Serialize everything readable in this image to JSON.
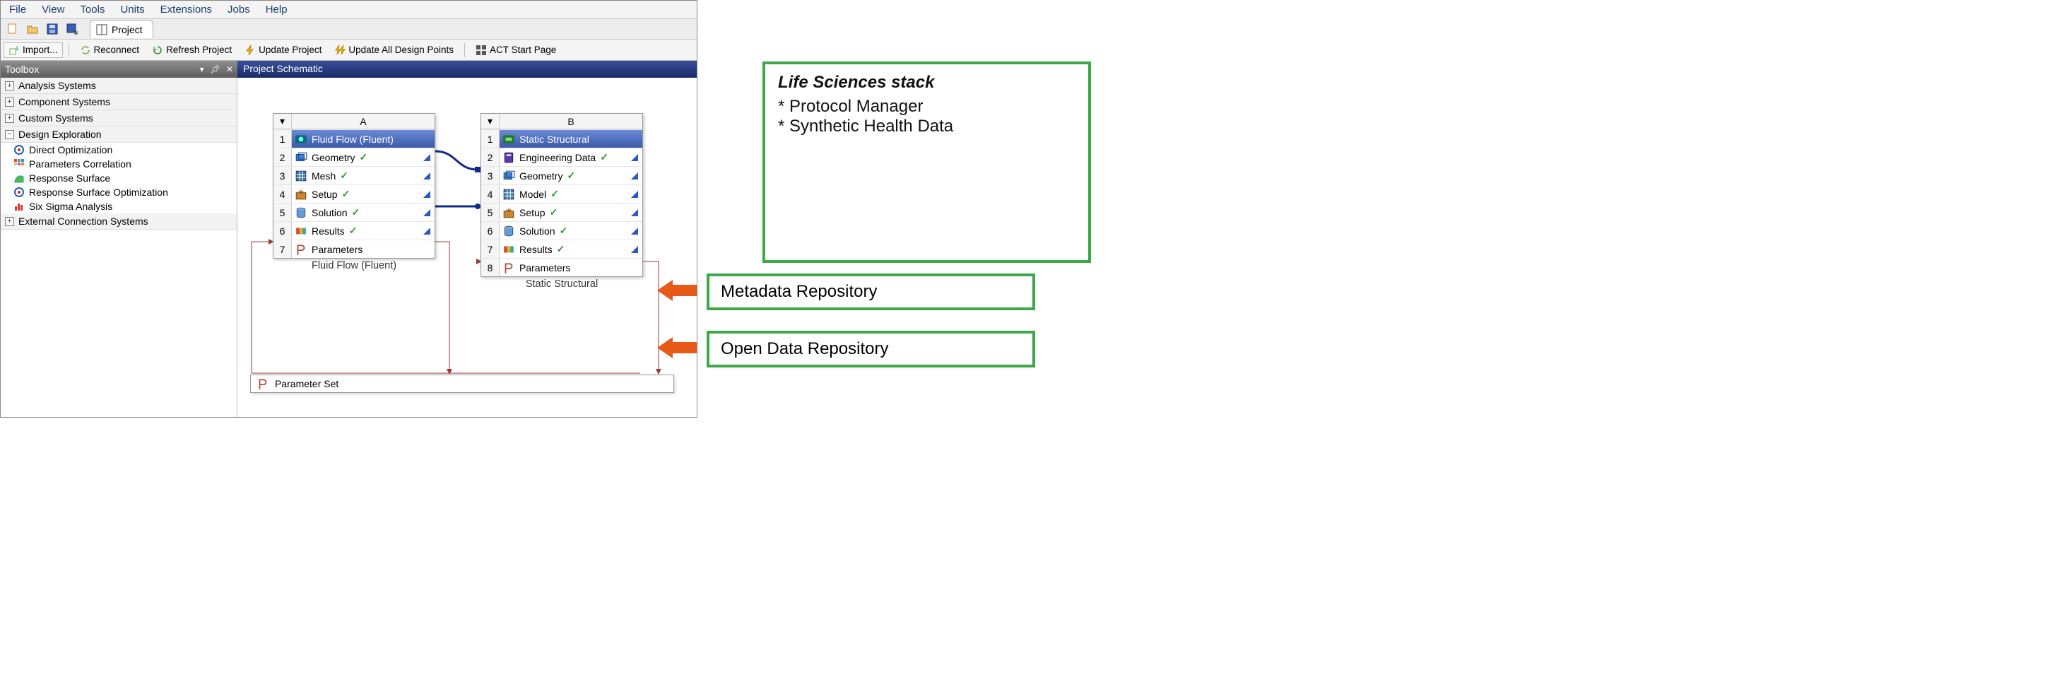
{
  "menu": {
    "items": [
      "File",
      "View",
      "Tools",
      "Units",
      "Extensions",
      "Jobs",
      "Help"
    ]
  },
  "tab": {
    "label": "Project"
  },
  "toolbar2": {
    "import": "Import...",
    "reconnect": "Reconnect",
    "refresh": "Refresh Project",
    "update": "Update Project",
    "update_all": "Update All Design Points",
    "act": "ACT Start Page"
  },
  "panels": {
    "toolbox": "Toolbox",
    "schematic": "Project Schematic"
  },
  "toolbox": {
    "categories": [
      {
        "label": "Analysis Systems",
        "expanded": false
      },
      {
        "label": "Component Systems",
        "expanded": false
      },
      {
        "label": "Custom Systems",
        "expanded": false
      },
      {
        "label": "Design Exploration",
        "expanded": true,
        "items": [
          {
            "label": "Direct Optimization",
            "icon": "target"
          },
          {
            "label": "Parameters Correlation",
            "icon": "grid"
          },
          {
            "label": "Response Surface",
            "icon": "surface"
          },
          {
            "label": "Response Surface Optimization",
            "icon": "target"
          },
          {
            "label": "Six Sigma Analysis",
            "icon": "bars"
          }
        ]
      },
      {
        "label": "External Connection Systems",
        "expanded": false
      }
    ]
  },
  "systems": {
    "a": {
      "col": "A",
      "title": "Fluid Flow (Fluent)",
      "caption": "Fluid Flow (Fluent)",
      "rows": [
        {
          "n": "2",
          "label": "Geometry",
          "icon": "geom",
          "ok": true,
          "flag": true
        },
        {
          "n": "3",
          "label": "Mesh",
          "icon": "mesh",
          "ok": true,
          "flag": true
        },
        {
          "n": "4",
          "label": "Setup",
          "icon": "setup",
          "ok": true,
          "flag": true
        },
        {
          "n": "5",
          "label": "Solution",
          "icon": "sol",
          "ok": true,
          "flag": true
        },
        {
          "n": "6",
          "label": "Results",
          "icon": "res",
          "ok": true,
          "flag": true
        },
        {
          "n": "7",
          "label": "Parameters",
          "icon": "param",
          "ok": false,
          "flag": false
        }
      ]
    },
    "b": {
      "col": "B",
      "title": "Static Structural",
      "caption": "Static Structural",
      "rows": [
        {
          "n": "2",
          "label": "Engineering Data",
          "icon": "eng",
          "ok": true,
          "flag": true
        },
        {
          "n": "3",
          "label": "Geometry",
          "icon": "geom",
          "ok": true,
          "flag": true
        },
        {
          "n": "4",
          "label": "Model",
          "icon": "mesh",
          "ok": true,
          "flag": true
        },
        {
          "n": "5",
          "label": "Setup",
          "icon": "setup",
          "ok": true,
          "flag": true
        },
        {
          "n": "6",
          "label": "Solution",
          "icon": "sol",
          "ok": true,
          "flag": true
        },
        {
          "n": "7",
          "label": "Results",
          "icon": "res",
          "ok": true,
          "flag": true
        },
        {
          "n": "8",
          "label": "Parameters",
          "icon": "param",
          "ok": false,
          "flag": false
        }
      ]
    }
  },
  "parameter_set": {
    "label": "Parameter Set"
  },
  "annotations": {
    "stack_title": "Life Sciences stack",
    "stack_items": [
      "* Protocol Manager",
      "* Synthetic Health Data"
    ],
    "bar1": "Metadata Repository",
    "bar2": "Open Data Repository"
  }
}
